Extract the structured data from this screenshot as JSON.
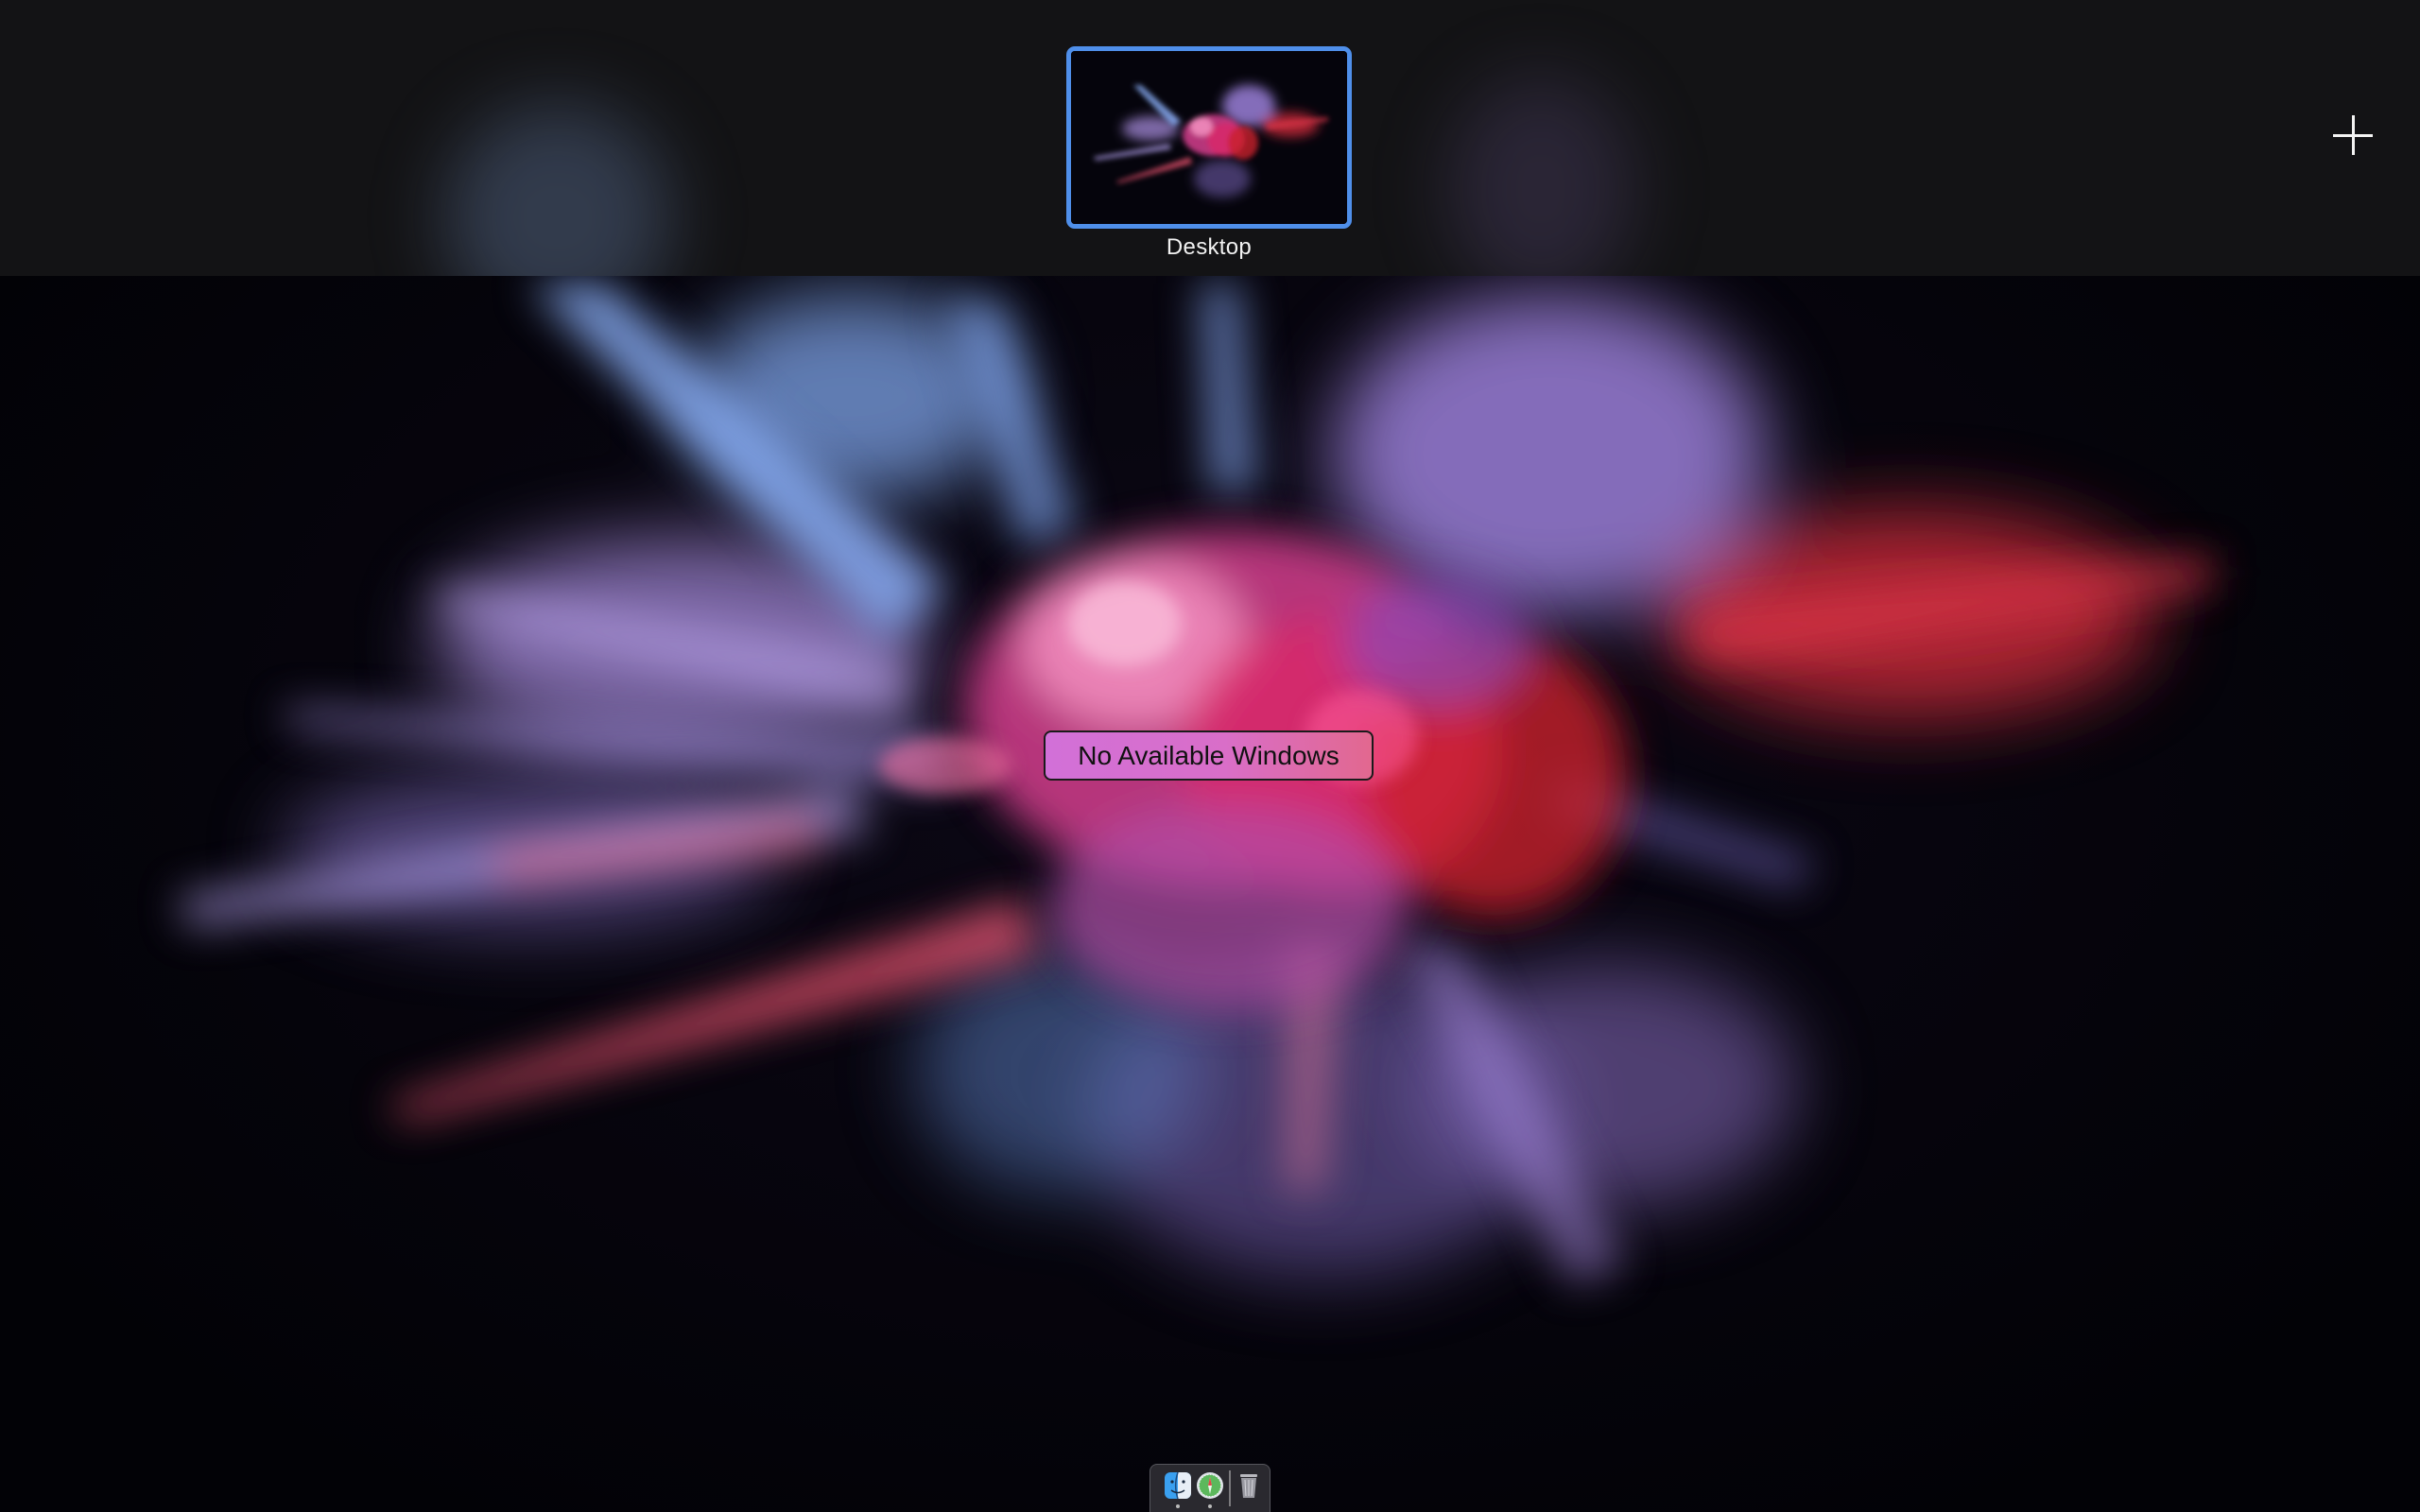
{
  "spaces_bar": {
    "space_label": "Desktop",
    "add_space_icon": "plus-icon",
    "selected_border_color": "#4f8fea"
  },
  "desktop": {
    "message": "No Available Windows"
  },
  "dock": {
    "items": [
      {
        "icon": "finder-icon",
        "running": true
      },
      {
        "icon": "safari-icon",
        "running": true
      },
      {
        "icon": "trash-icon",
        "running": false
      }
    ]
  }
}
